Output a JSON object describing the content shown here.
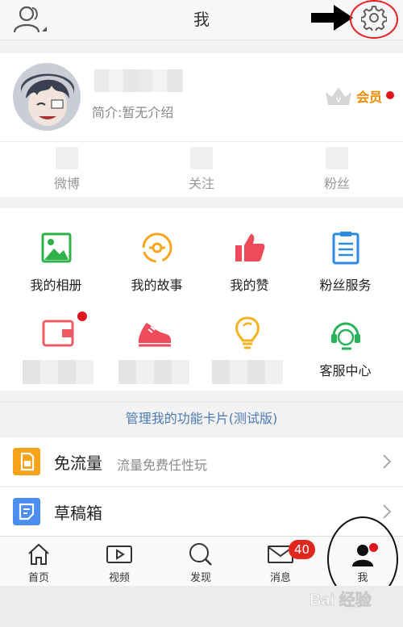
{
  "header": {
    "title": "我"
  },
  "profile": {
    "intro": "简介:暂无介绍",
    "vip_label": "会员"
  },
  "stats": [
    {
      "label": "微博"
    },
    {
      "label": "关注"
    },
    {
      "label": "粉丝"
    }
  ],
  "grid": {
    "row1": [
      {
        "label": "我的相册",
        "icon": "photo-album-icon"
      },
      {
        "label": "我的故事",
        "icon": "story-icon"
      },
      {
        "label": "我的赞",
        "icon": "thumbs-up-icon"
      },
      {
        "label": "粉丝服务",
        "icon": "clipboard-icon"
      }
    ],
    "row2": [
      {
        "icon": "wallet-icon"
      },
      {
        "icon": "sneaker-icon"
      },
      {
        "icon": "lightbulb-icon"
      },
      {
        "label": "客服中心",
        "icon": "headset-icon"
      }
    ]
  },
  "manage_cards": "管理我的功能卡片(测试版)",
  "list": [
    {
      "title": "免流量",
      "subtitle": "流量免费任性玩",
      "icon": "sim-card-icon",
      "color": "#f7a21b"
    },
    {
      "title": "草稿箱",
      "icon": "draft-icon",
      "color": "#4b8ef0"
    }
  ],
  "tabs": [
    {
      "label": "首页",
      "icon": "home-icon"
    },
    {
      "label": "视频",
      "icon": "video-icon"
    },
    {
      "label": "发现",
      "icon": "discover-icon"
    },
    {
      "label": "消息",
      "icon": "mail-icon",
      "badge": "40"
    },
    {
      "label": "我",
      "icon": "profile-icon"
    }
  ],
  "colors": {
    "accent_red": "#e0161d",
    "vip_orange": "#f08a00",
    "link_blue": "#4c7ab3"
  },
  "watermark": "Bai 经验"
}
